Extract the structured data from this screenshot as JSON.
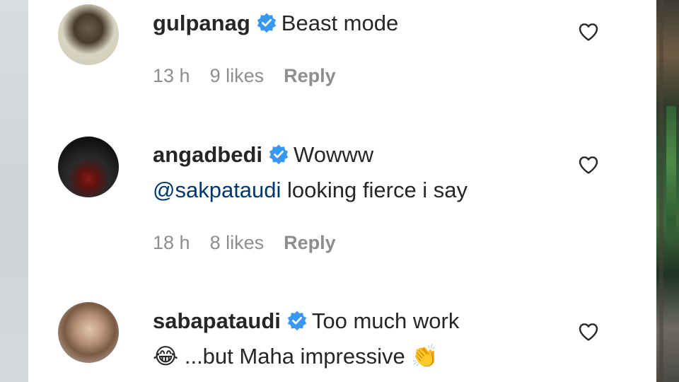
{
  "comments": [
    {
      "username": "gulpanag",
      "text": "Beast mode",
      "mention": "",
      "text_after": "",
      "emoji_lead": "",
      "text_line2": "",
      "emoji_trail": "",
      "time": "13 h",
      "likes": "9 likes",
      "reply": "Reply",
      "verified_icon": "verified-badge-icon",
      "like_icon": "heart-outline-icon",
      "avatar": "avatar-photo"
    },
    {
      "username": "angadbedi",
      "text": "Wowww",
      "mention": "@sakpataudi",
      "text_after": " looking fierce i say",
      "emoji_lead": "",
      "text_line2": "",
      "emoji_trail": "",
      "time": "18 h",
      "likes": "8 likes",
      "reply": "Reply",
      "verified_icon": "verified-badge-icon",
      "like_icon": "heart-outline-icon",
      "avatar": "avatar-photo"
    },
    {
      "username": "sabapataudi",
      "text": "Too much work",
      "mention": "",
      "text_after": "",
      "emoji_lead": "😂",
      "text_line2": " ...but Maha impressive ",
      "emoji_trail": "👏",
      "time": "",
      "likes": "",
      "reply": "",
      "verified_icon": "verified-badge-icon",
      "like_icon": "heart-outline-icon",
      "avatar": "avatar-photo"
    }
  ],
  "colors": {
    "username": "#262626",
    "mention": "#00376b",
    "meta": "#8e8e8e",
    "verified": "#3897f0"
  }
}
